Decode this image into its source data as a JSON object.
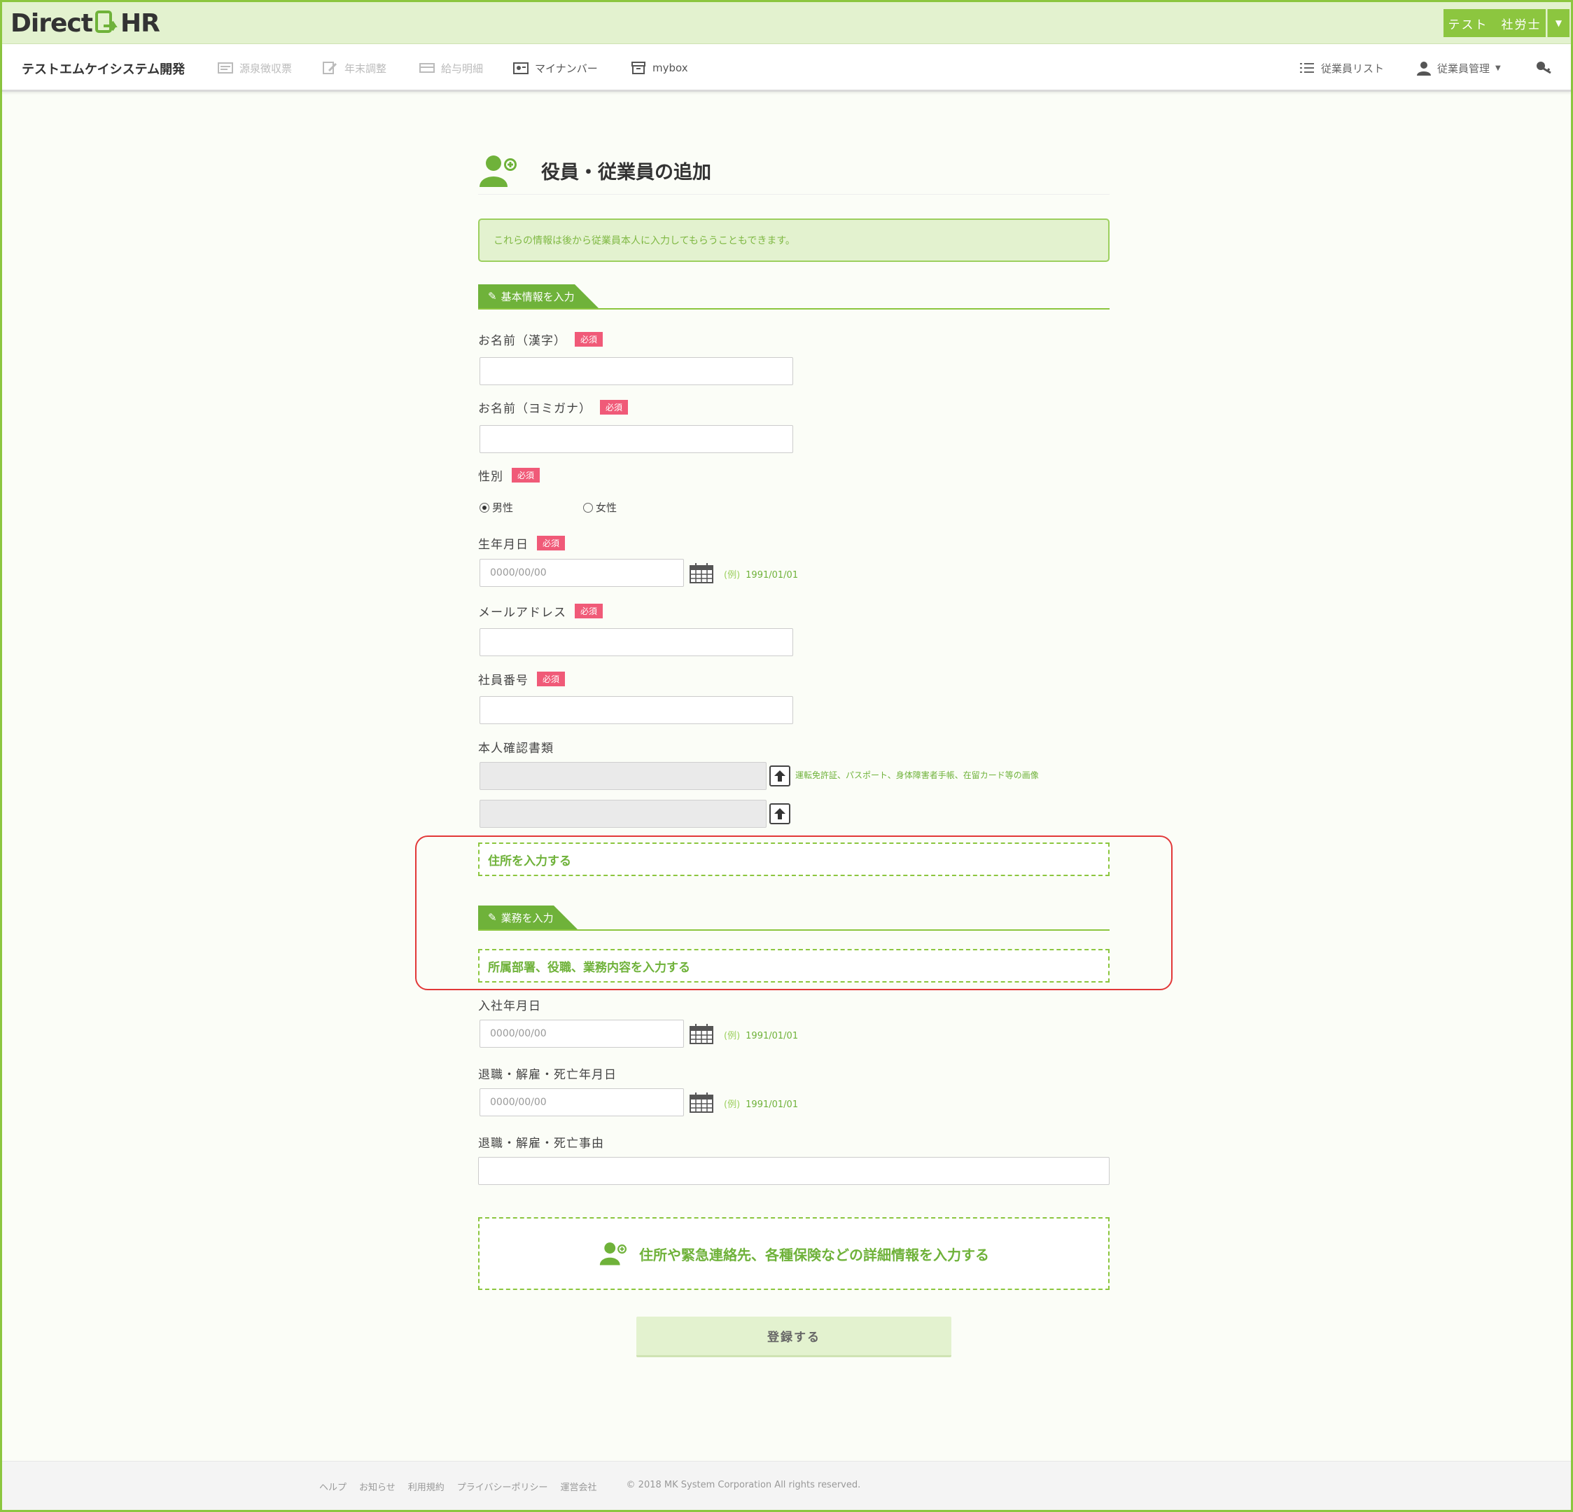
{
  "header": {
    "logo_left": "Direct",
    "logo_right": "HR",
    "user_name": "テスト　社労士"
  },
  "nav": {
    "company": "テストエムケイシステム開発",
    "items": [
      {
        "label": "源泉徴収票",
        "icon": "receipt-icon"
      },
      {
        "label": "年末調整",
        "icon": "edit-doc-icon"
      },
      {
        "label": "給与明細",
        "icon": "payslip-icon"
      },
      {
        "label": "マイナンバー",
        "icon": "id-card-icon"
      },
      {
        "label": "mybox",
        "icon": "box-icon"
      }
    ],
    "right": [
      {
        "label": "従業員リスト",
        "icon": "list-icon"
      },
      {
        "label": "従業員管理",
        "icon": "user-icon"
      }
    ]
  },
  "page": {
    "title": "役員・従業員の追加",
    "notice": "これらの情報は後から従業員本人に入力してもらうこともできます。",
    "section_basic": "基本情報を入力",
    "section_work": "業務を入力",
    "required": "必須",
    "fields": {
      "name_kanji": "お名前（漢字）",
      "name_kana": "お名前（ヨミガナ）",
      "gender": "性別",
      "male": "男性",
      "female": "女性",
      "birthdate": "生年月日",
      "email": "メールアドレス",
      "employee_no": "社員番号",
      "id_docs": "本人確認書類",
      "id_docs_hint": "運転免許証、パスポート、身体障害者手帳、在留カード等の画像",
      "hire_date": "入社年月日",
      "retire_date": "退職・解雇・死亡年月日",
      "retire_reason": "退職・解雇・死亡事由"
    },
    "date_placeholder": "0000/00/00",
    "example_prefix": "(例)",
    "example_date": "1991/01/01",
    "address_link": "住所を入力する",
    "dept_link": "所属部署、役職、業務内容を入力する",
    "detail_link": "住所や緊急連絡先、各種保険などの詳細情報を入力する",
    "submit": "登録する"
  },
  "footer": {
    "links": [
      "ヘルプ",
      "お知らせ",
      "利用規約",
      "プライバシーポリシー",
      "運営会社"
    ],
    "copyright": "© 2018 MK System Corporation All rights reserved."
  },
  "colors": {
    "accent": "#8cc63f",
    "accent_dark": "#6fb23a",
    "header_bg": "#e3f2cf",
    "required": "#f05a78",
    "highlight": "#e23838"
  }
}
